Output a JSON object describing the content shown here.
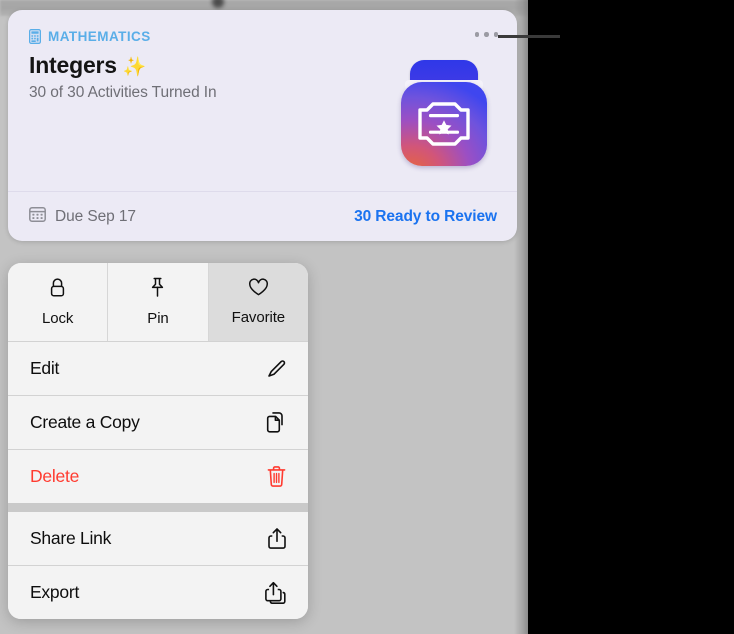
{
  "card": {
    "subject_icon": "calculator-icon",
    "subject": "MATHEMATICS",
    "title": "Integers",
    "title_emoji": "✨",
    "progress": "30 of 30 Activities Turned In",
    "more_icon": "ellipsis-icon",
    "app_art_icon": "certificate-app-icon",
    "footer": {
      "due_icon": "calendar-icon",
      "due": "Due Sep 17",
      "review_link": "30 Ready to Review"
    },
    "colors": {
      "background": "#ECEAF5",
      "subject": "#5AAEE8",
      "link": "#1A73F0",
      "muted_text": "#6F6F76"
    }
  },
  "context_menu": {
    "quick_actions": [
      {
        "label": "Lock",
        "icon": "lock-icon"
      },
      {
        "label": "Pin",
        "icon": "pin-icon"
      },
      {
        "label": "Favorite",
        "icon": "heart-icon"
      }
    ],
    "items": [
      {
        "label": "Edit",
        "icon": "pencil-icon",
        "destructive": false
      },
      {
        "label": "Create a Copy",
        "icon": "duplicate-icon",
        "destructive": false
      },
      {
        "label": "Delete",
        "icon": "trash-icon",
        "destructive": true
      },
      {
        "label": "Share Link",
        "icon": "share-icon",
        "destructive": false
      },
      {
        "label": "Export",
        "icon": "export-icon",
        "destructive": false
      }
    ],
    "colors": {
      "background": "#F3F3F3",
      "destructive": "#FF3B30",
      "selected": "#DCDCDC"
    }
  }
}
